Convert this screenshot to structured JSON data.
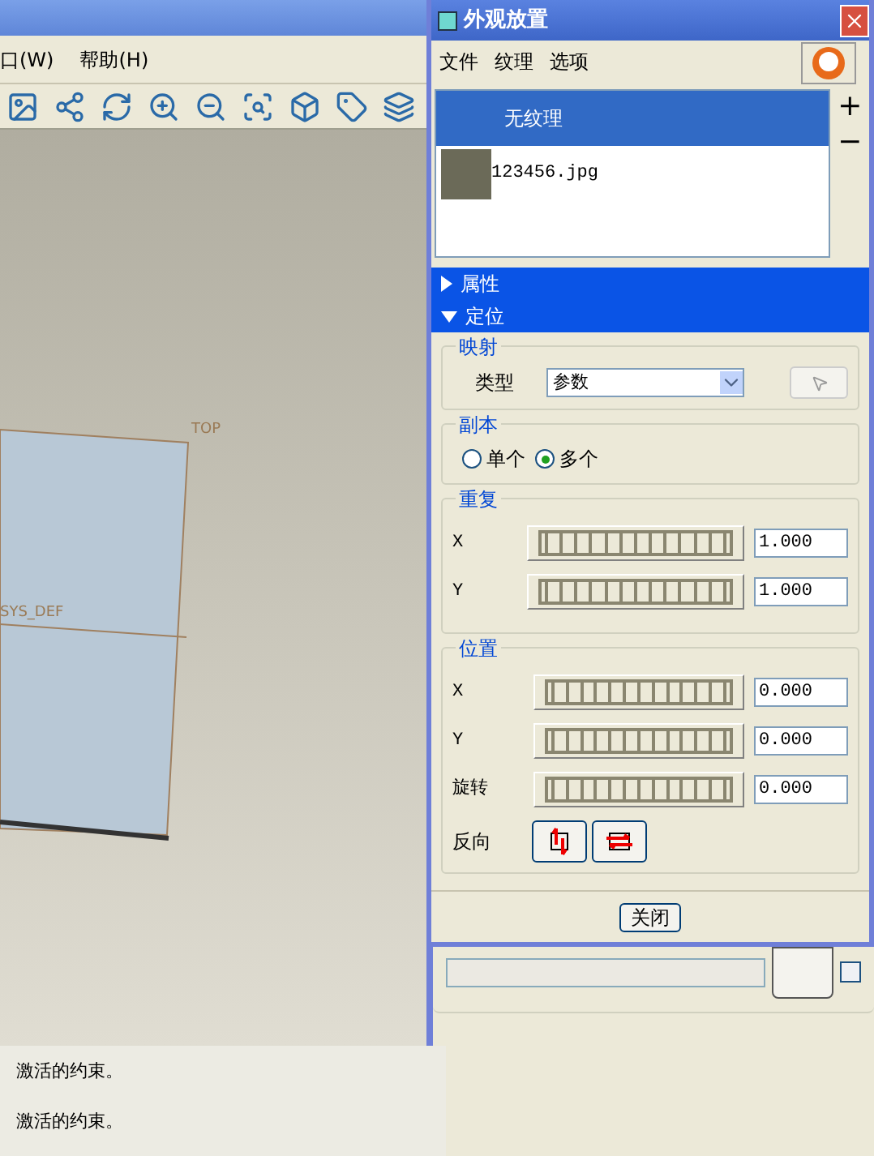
{
  "app": {
    "menu": [
      {
        "label": "口(W)"
      },
      {
        "label": "帮助(H)"
      }
    ],
    "canvas": {
      "labels": [
        "TOP",
        "SYS_DEF"
      ]
    },
    "messages": [
      "激活的约束。",
      "激活的约束。"
    ],
    "side_panel": {
      "checked": false
    }
  },
  "dialog": {
    "title": "外观放置",
    "menu": [
      "文件",
      "纹理",
      "选项"
    ],
    "textures": [
      {
        "label": "无纹理",
        "selected": true,
        "kind": "none"
      },
      {
        "label": "123456.jpg",
        "selected": false,
        "kind": "image"
      }
    ],
    "add": "+",
    "remove": "−",
    "sections": [
      {
        "label": "属性",
        "expanded": false
      },
      {
        "label": "定位",
        "expanded": true
      }
    ],
    "mapping": {
      "title": "映射",
      "type_label": "类型",
      "type_value": "参数"
    },
    "copies": {
      "title": "副本",
      "options": [
        {
          "label": "单个",
          "selected": false
        },
        {
          "label": "多个",
          "selected": true
        }
      ]
    },
    "repeat": {
      "title": "重复",
      "rows": [
        {
          "label": "X",
          "value": "1.000"
        },
        {
          "label": "Y",
          "value": "1.000"
        }
      ]
    },
    "position": {
      "title": "位置",
      "rows": [
        {
          "label": "X",
          "value": "0.000"
        },
        {
          "label": "Y",
          "value": "0.000"
        },
        {
          "label": "旋转",
          "value": "0.000"
        }
      ],
      "reverse_label": "反向"
    },
    "close": "关闭"
  }
}
